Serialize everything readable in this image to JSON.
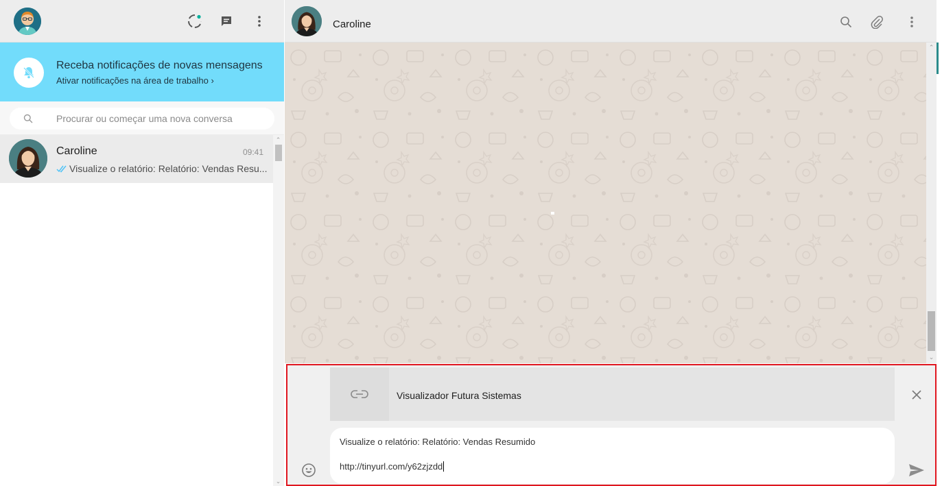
{
  "left_header": {
    "icons": [
      "status-icon",
      "new-chat-icon",
      "menu-icon"
    ]
  },
  "notification": {
    "title": "Receba notificações de novas mensagens",
    "link": "Ativar notificações na área de trabalho ›"
  },
  "search": {
    "placeholder": "Procurar ou começar uma nova conversa"
  },
  "chats": [
    {
      "name": "Caroline",
      "time": "09:41",
      "preview": "Visualize o relatório: Relatório: Vendas Resu..."
    }
  ],
  "conversation": {
    "contact_name": "Caroline",
    "icons": [
      "search-icon",
      "attach-icon",
      "menu-icon"
    ]
  },
  "compose": {
    "link_preview_title": "Visualizador Futura Sistemas",
    "message_line1": "Visualize o relatório: Relatório: Vendas Resumido",
    "message_line2": "http://tinyurl.com/y62zjzdd"
  },
  "colors": {
    "notification_bg": "#72dcfb",
    "chat_bg": "#e5ddd5",
    "highlight_border": "#e0161f",
    "read_ticks": "#4fc3f7"
  }
}
